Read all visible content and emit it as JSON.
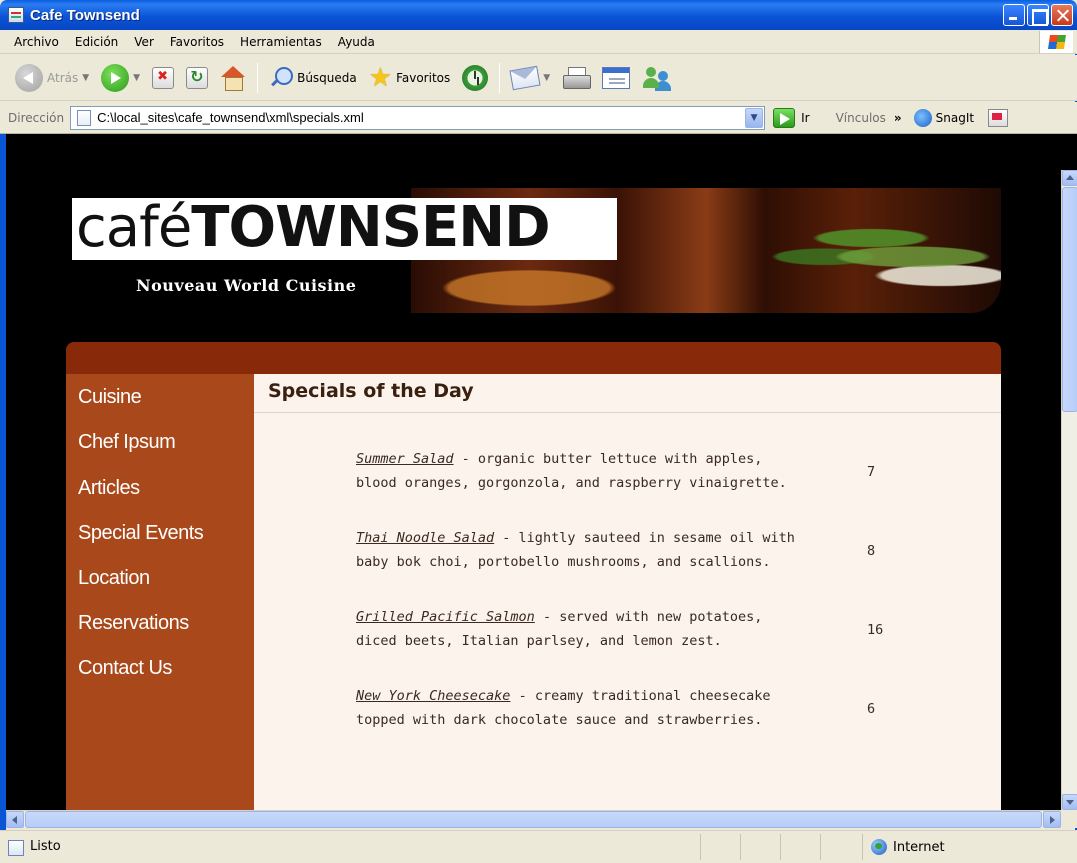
{
  "window": {
    "title": "Cafe Townsend"
  },
  "menu": [
    "Archivo",
    "Edición",
    "Ver",
    "Favoritos",
    "Herramientas",
    "Ayuda"
  ],
  "toolbar": {
    "back_label": "Atrás",
    "search_label": "Búsqueda",
    "favorites_label": "Favoritos"
  },
  "address": {
    "label": "Dirección",
    "url": "C:\\local_sites\\cafe_townsend\\xml\\specials.xml",
    "go_label": "Ir",
    "links_label": "Vínculos",
    "snagit_label": "SnagIt"
  },
  "site": {
    "logo_cafe": "café",
    "logo_townsend": "TOWNSEND",
    "tagline": "Nouveau World Cuisine",
    "nav": [
      "Cuisine",
      "Chef Ipsum",
      "Articles",
      "Special Events",
      "Location",
      "Reservations",
      "Contact Us"
    ],
    "page_title": "Specials of the Day",
    "specials": [
      {
        "name": "Summer Salad",
        "description": " - organic butter lettuce with apples, blood oranges, gorgonzola, and raspberry vinaigrette.",
        "price": "7"
      },
      {
        "name": "Thai Noodle Salad",
        "description": " - lightly sauteed in sesame oil with baby bok choi, portobello mushrooms, and scallions.",
        "price": "8"
      },
      {
        "name": "Grilled Pacific Salmon",
        "description": " - served with new potatoes, diced beets, Italian parlsey, and lemon zest.",
        "price": "16"
      },
      {
        "name": "New York Cheesecake",
        "description": " - creamy traditional cheesecake topped with dark chocolate sauce and strawberries.",
        "price": "6"
      }
    ]
  },
  "status": {
    "text": "Listo",
    "zone": "Internet"
  },
  "colors": {
    "xp_blue": "#0a54d6",
    "nav_bg": "#a9481a",
    "header_bar": "#882a09",
    "content_bg": "#fbf3ec"
  }
}
